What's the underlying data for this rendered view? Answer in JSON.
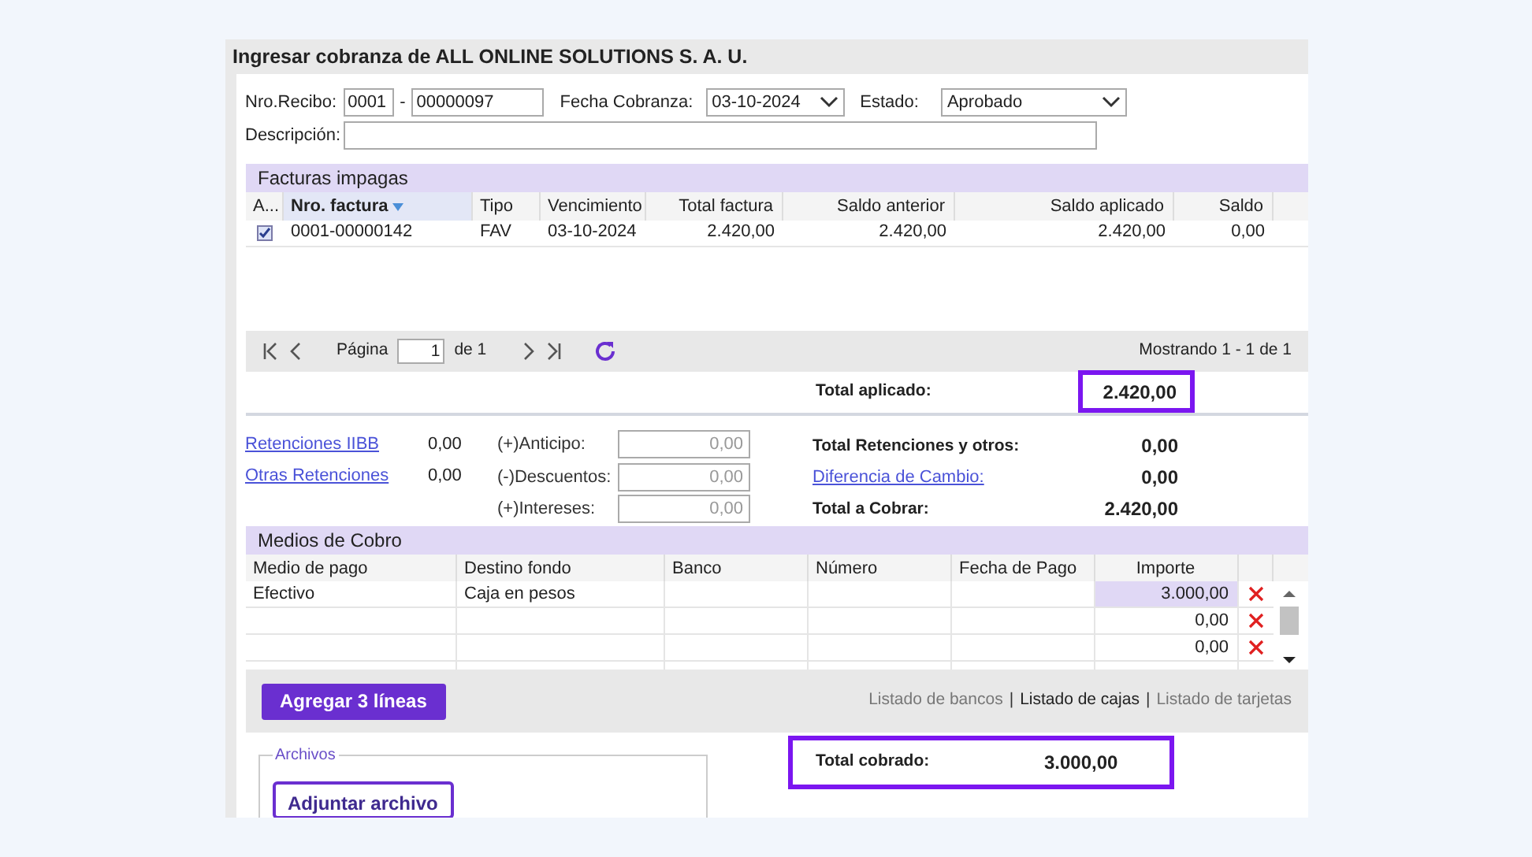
{
  "window": {
    "title": "Ingresar cobranza de ALL ONLINE SOLUTIONS S. A. U."
  },
  "form": {
    "recibo_label": "Nro.Recibo:",
    "recibo_prefix": "0001",
    "recibo_sep": "-",
    "recibo_number": "00000097",
    "fecha_label": "Fecha Cobranza:",
    "fecha_value": "03-10-2024",
    "estado_label": "Estado:",
    "estado_value": "Aprobado",
    "descripcion_label": "Descripción:"
  },
  "facturas": {
    "title": "Facturas impagas",
    "columns": [
      {
        "label": "A...",
        "sorted": false
      },
      {
        "label": "Nro. factura",
        "sorted": true
      },
      {
        "label": "Tipo",
        "sorted": false
      },
      {
        "label": "Vencimiento",
        "sorted": false
      },
      {
        "label": "Total factura",
        "sorted": false
      },
      {
        "label": "Saldo anterior",
        "sorted": false
      },
      {
        "label": "Saldo aplicado",
        "sorted": false
      },
      {
        "label": "Saldo",
        "sorted": false
      }
    ],
    "rows": [
      {
        "checked": true,
        "cells": [
          "",
          "0001-00000142",
          "FAV",
          "03-10-2024",
          "2.420,00",
          "2.420,00",
          "2.420,00",
          "0,00"
        ]
      }
    ]
  },
  "pagination": {
    "page_label": "Página",
    "page": "1",
    "of_label": "de 1",
    "showing": "Mostrando 1 - 1 de 1"
  },
  "totals": {
    "aplicado_label": "Total aplicado:",
    "aplicado_value": "2.420,00",
    "left": [
      {
        "label": "Retenciones IIBB",
        "value": "0,00"
      },
      {
        "label": "Otras Retenciones",
        "value": "0,00"
      }
    ],
    "adjustments": [
      {
        "label": "(+)Anticipo:",
        "placeholder": "0,00"
      },
      {
        "label": "(-)Descuentos:",
        "placeholder": "0,00"
      },
      {
        "label": "(+)Intereses:",
        "placeholder": "0,00"
      }
    ],
    "right": [
      {
        "label": "Total Retenciones y otros:",
        "value": "0,00",
        "kind": "text"
      },
      {
        "label": "Diferencia de Cambio:",
        "value": "0,00",
        "kind": "link"
      },
      {
        "label": "Total a Cobrar:",
        "value": "2.420,00",
        "kind": "text"
      }
    ]
  },
  "medios": {
    "title": "Medios de Cobro",
    "columns": [
      "Medio de pago",
      "Destino fondo",
      "Banco",
      "Número",
      "Fecha de Pago",
      "Importe"
    ],
    "rows": [
      {
        "cells": [
          "Efectivo",
          "Caja en pesos",
          "",
          "",
          "",
          "3.000,00"
        ],
        "selected": true
      },
      {
        "cells": [
          "",
          "",
          "",
          "",
          "",
          "0,00"
        ],
        "selected": false
      },
      {
        "cells": [
          "",
          "",
          "",
          "",
          "",
          "0,00"
        ],
        "selected": false
      }
    ],
    "add_button": "Agregar 3 líneas",
    "links": [
      {
        "label": "Listado de bancos",
        "selected": false
      },
      {
        "label": "Listado de cajas",
        "selected": true
      },
      {
        "label": "Listado de tarjetas",
        "selected": false
      }
    ],
    "link_separator": "|"
  },
  "archivos": {
    "legend": "Archivos",
    "button": "Adjuntar archivo"
  },
  "cobrado": {
    "label": "Total cobrado:",
    "value": "3.000,00"
  }
}
